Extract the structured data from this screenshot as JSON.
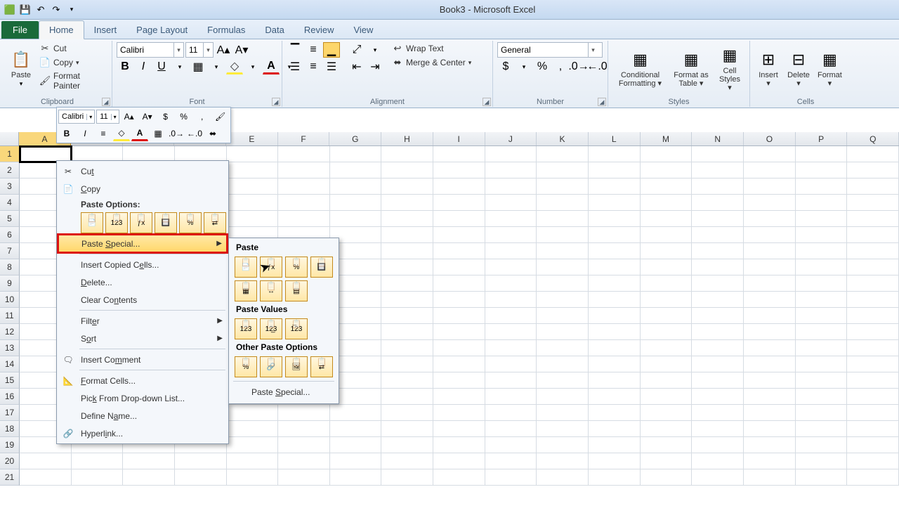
{
  "title": "Book3 - Microsoft Excel",
  "tabs": {
    "file": "File",
    "home": "Home",
    "insert": "Insert",
    "page_layout": "Page Layout",
    "formulas": "Formulas",
    "data": "Data",
    "review": "Review",
    "view": "View"
  },
  "clipboard": {
    "label": "Clipboard",
    "paste": "Paste",
    "cut": "Cut",
    "copy": "Copy",
    "format_painter": "Format Painter"
  },
  "font": {
    "label": "Font",
    "name": "Calibri",
    "size": "11"
  },
  "alignment": {
    "label": "Alignment",
    "wrap": "Wrap Text",
    "merge": "Merge & Center"
  },
  "number": {
    "label": "Number",
    "format": "General"
  },
  "styles": {
    "label": "Styles",
    "cond": "Conditional Formatting",
    "table": "Format as Table",
    "cell": "Cell Styles"
  },
  "cells": {
    "label": "Cells",
    "insert": "Insert",
    "delete": "Delete",
    "format": "Format"
  },
  "mini": {
    "font": "Calibri",
    "size": "11"
  },
  "columns": [
    "A",
    "B",
    "C",
    "D",
    "E",
    "F",
    "G",
    "H",
    "I",
    "J",
    "K",
    "L",
    "M",
    "N",
    "O",
    "P",
    "Q"
  ],
  "rows": [
    "1",
    "2",
    "3",
    "4",
    "5",
    "6",
    "7",
    "8",
    "9",
    "10",
    "11",
    "12",
    "13",
    "14",
    "15",
    "16",
    "17",
    "18",
    "19",
    "20",
    "21"
  ],
  "ctx": {
    "cut": "Cut",
    "copy": "Copy",
    "paste_options": "Paste Options:",
    "paste_special": "Paste Special...",
    "insert_copied": "Insert Copied Cells...",
    "delete": "Delete...",
    "clear": "Clear Contents",
    "filter": "Filter",
    "sort": "Sort",
    "insert_comment": "Insert Comment",
    "format_cells": "Format Cells...",
    "pick": "Pick From Drop-down List...",
    "define": "Define Name...",
    "hyperlink": "Hyperlink..."
  },
  "sub": {
    "paste": "Paste",
    "paste_values": "Paste Values",
    "other": "Other Paste Options",
    "paste_special": "Paste Special..."
  },
  "paste_opts": [
    "📄",
    "123",
    "ƒx",
    "🔲",
    "%",
    "⇄"
  ],
  "sub_paste_row1": [
    "📄",
    "ƒx",
    "%",
    "🔲"
  ],
  "sub_paste_row2": [
    "▦",
    "↔",
    "▤"
  ],
  "sub_values": [
    "123",
    "12̲3",
    "1̅23"
  ],
  "sub_other": [
    "%",
    "🔗",
    "🖼",
    "⇄"
  ]
}
